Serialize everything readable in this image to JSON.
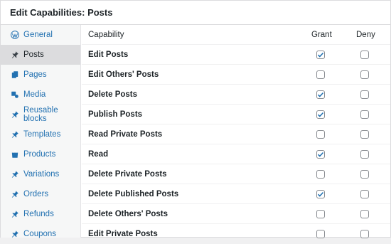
{
  "panel": {
    "title": "Edit Capabilities: Posts"
  },
  "sidebar": {
    "items": [
      {
        "label": "General",
        "icon": "wordpress-icon",
        "active": false
      },
      {
        "label": "Posts",
        "icon": "pin-icon",
        "active": true
      },
      {
        "label": "Pages",
        "icon": "pages-icon",
        "active": false
      },
      {
        "label": "Media",
        "icon": "media-icon",
        "active": false
      },
      {
        "label": "Reusable blocks",
        "icon": "pin-icon",
        "active": false
      },
      {
        "label": "Templates",
        "icon": "pin-icon",
        "active": false
      },
      {
        "label": "Products",
        "icon": "products-icon",
        "active": false
      },
      {
        "label": "Variations",
        "icon": "pin-icon",
        "active": false
      },
      {
        "label": "Orders",
        "icon": "pin-icon",
        "active": false
      },
      {
        "label": "Refunds",
        "icon": "pin-icon",
        "active": false
      },
      {
        "label": "Coupons",
        "icon": "pin-icon",
        "active": false
      }
    ]
  },
  "table": {
    "headers": {
      "capability": "Capability",
      "grant": "Grant",
      "deny": "Deny"
    },
    "rows": [
      {
        "capability": "Edit Posts",
        "grant": true,
        "deny": false
      },
      {
        "capability": "Edit Others' Posts",
        "grant": false,
        "deny": false
      },
      {
        "capability": "Delete Posts",
        "grant": true,
        "deny": false
      },
      {
        "capability": "Publish Posts",
        "grant": true,
        "deny": false
      },
      {
        "capability": "Read Private Posts",
        "grant": false,
        "deny": false
      },
      {
        "capability": "Read",
        "grant": true,
        "deny": false
      },
      {
        "capability": "Delete Private Posts",
        "grant": false,
        "deny": false
      },
      {
        "capability": "Delete Published Posts",
        "grant": true,
        "deny": false
      },
      {
        "capability": "Delete Others' Posts",
        "grant": false,
        "deny": false
      },
      {
        "capability": "Edit Private Posts",
        "grant": false,
        "deny": false
      }
    ]
  },
  "colors": {
    "link": "#2271b1",
    "check": "#2271b1",
    "active_bg": "#dcdcde"
  }
}
